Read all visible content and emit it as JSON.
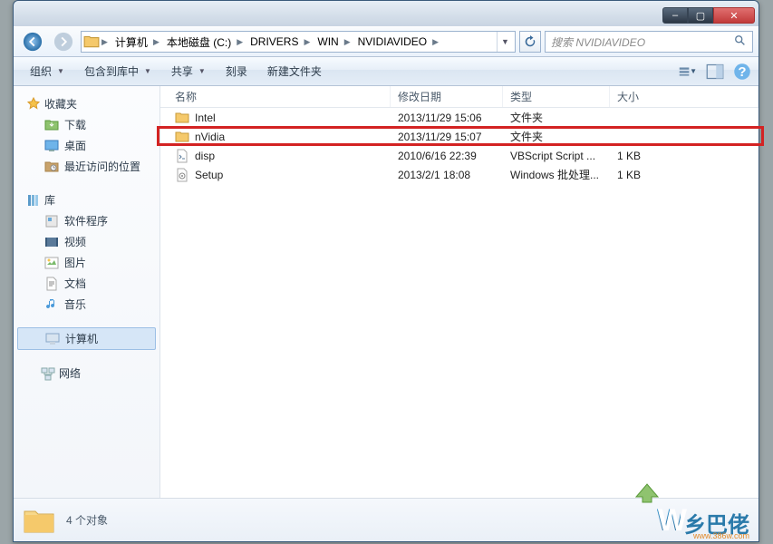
{
  "window_controls": {
    "min": "–",
    "max": "▢",
    "close": "✕"
  },
  "breadcrumb": {
    "items": [
      "计算机",
      "本地磁盘 (C:)",
      "DRIVERS",
      "WIN",
      "NVIDIAVIDEO"
    ]
  },
  "search": {
    "placeholder": "搜索 NVIDIAVIDEO"
  },
  "toolbar": {
    "organize": "组织",
    "include": "包含到库中",
    "share": "共享",
    "burn": "刻录",
    "newfolder": "新建文件夹"
  },
  "sidebar": {
    "favorites": {
      "label": "收藏夹",
      "items": [
        {
          "icon": "download",
          "label": "下载"
        },
        {
          "icon": "desktop",
          "label": "桌面"
        },
        {
          "icon": "recent",
          "label": "最近访问的位置"
        }
      ]
    },
    "libraries": {
      "label": "库",
      "items": [
        {
          "icon": "app",
          "label": "软件程序"
        },
        {
          "icon": "video",
          "label": "视频"
        },
        {
          "icon": "picture",
          "label": "图片"
        },
        {
          "icon": "document",
          "label": "文档"
        },
        {
          "icon": "music",
          "label": "音乐"
        }
      ]
    },
    "computer": {
      "label": "计算机"
    },
    "network": {
      "label": "网络"
    }
  },
  "columns": {
    "name": "名称",
    "date": "修改日期",
    "type": "类型",
    "size": "大小"
  },
  "rows": [
    {
      "icon": "folder",
      "name": "Intel",
      "date": "2013/11/29 15:06",
      "type": "文件夹",
      "size": ""
    },
    {
      "icon": "folder",
      "name": "nVidia",
      "date": "2013/11/29 15:07",
      "type": "文件夹",
      "size": ""
    },
    {
      "icon": "script",
      "name": "disp",
      "date": "2010/6/16 22:39",
      "type": "VBScript Script ...",
      "size": "1 KB"
    },
    {
      "icon": "batch",
      "name": "Setup",
      "date": "2013/2/1 18:08",
      "type": "Windows 批处理...",
      "size": "1 KB"
    }
  ],
  "highlight_row_index": 1,
  "status": {
    "count_text": "4 个对象"
  },
  "watermark": {
    "logo": "W",
    "text": "乡巴佬",
    "url": "www.386w.com"
  }
}
